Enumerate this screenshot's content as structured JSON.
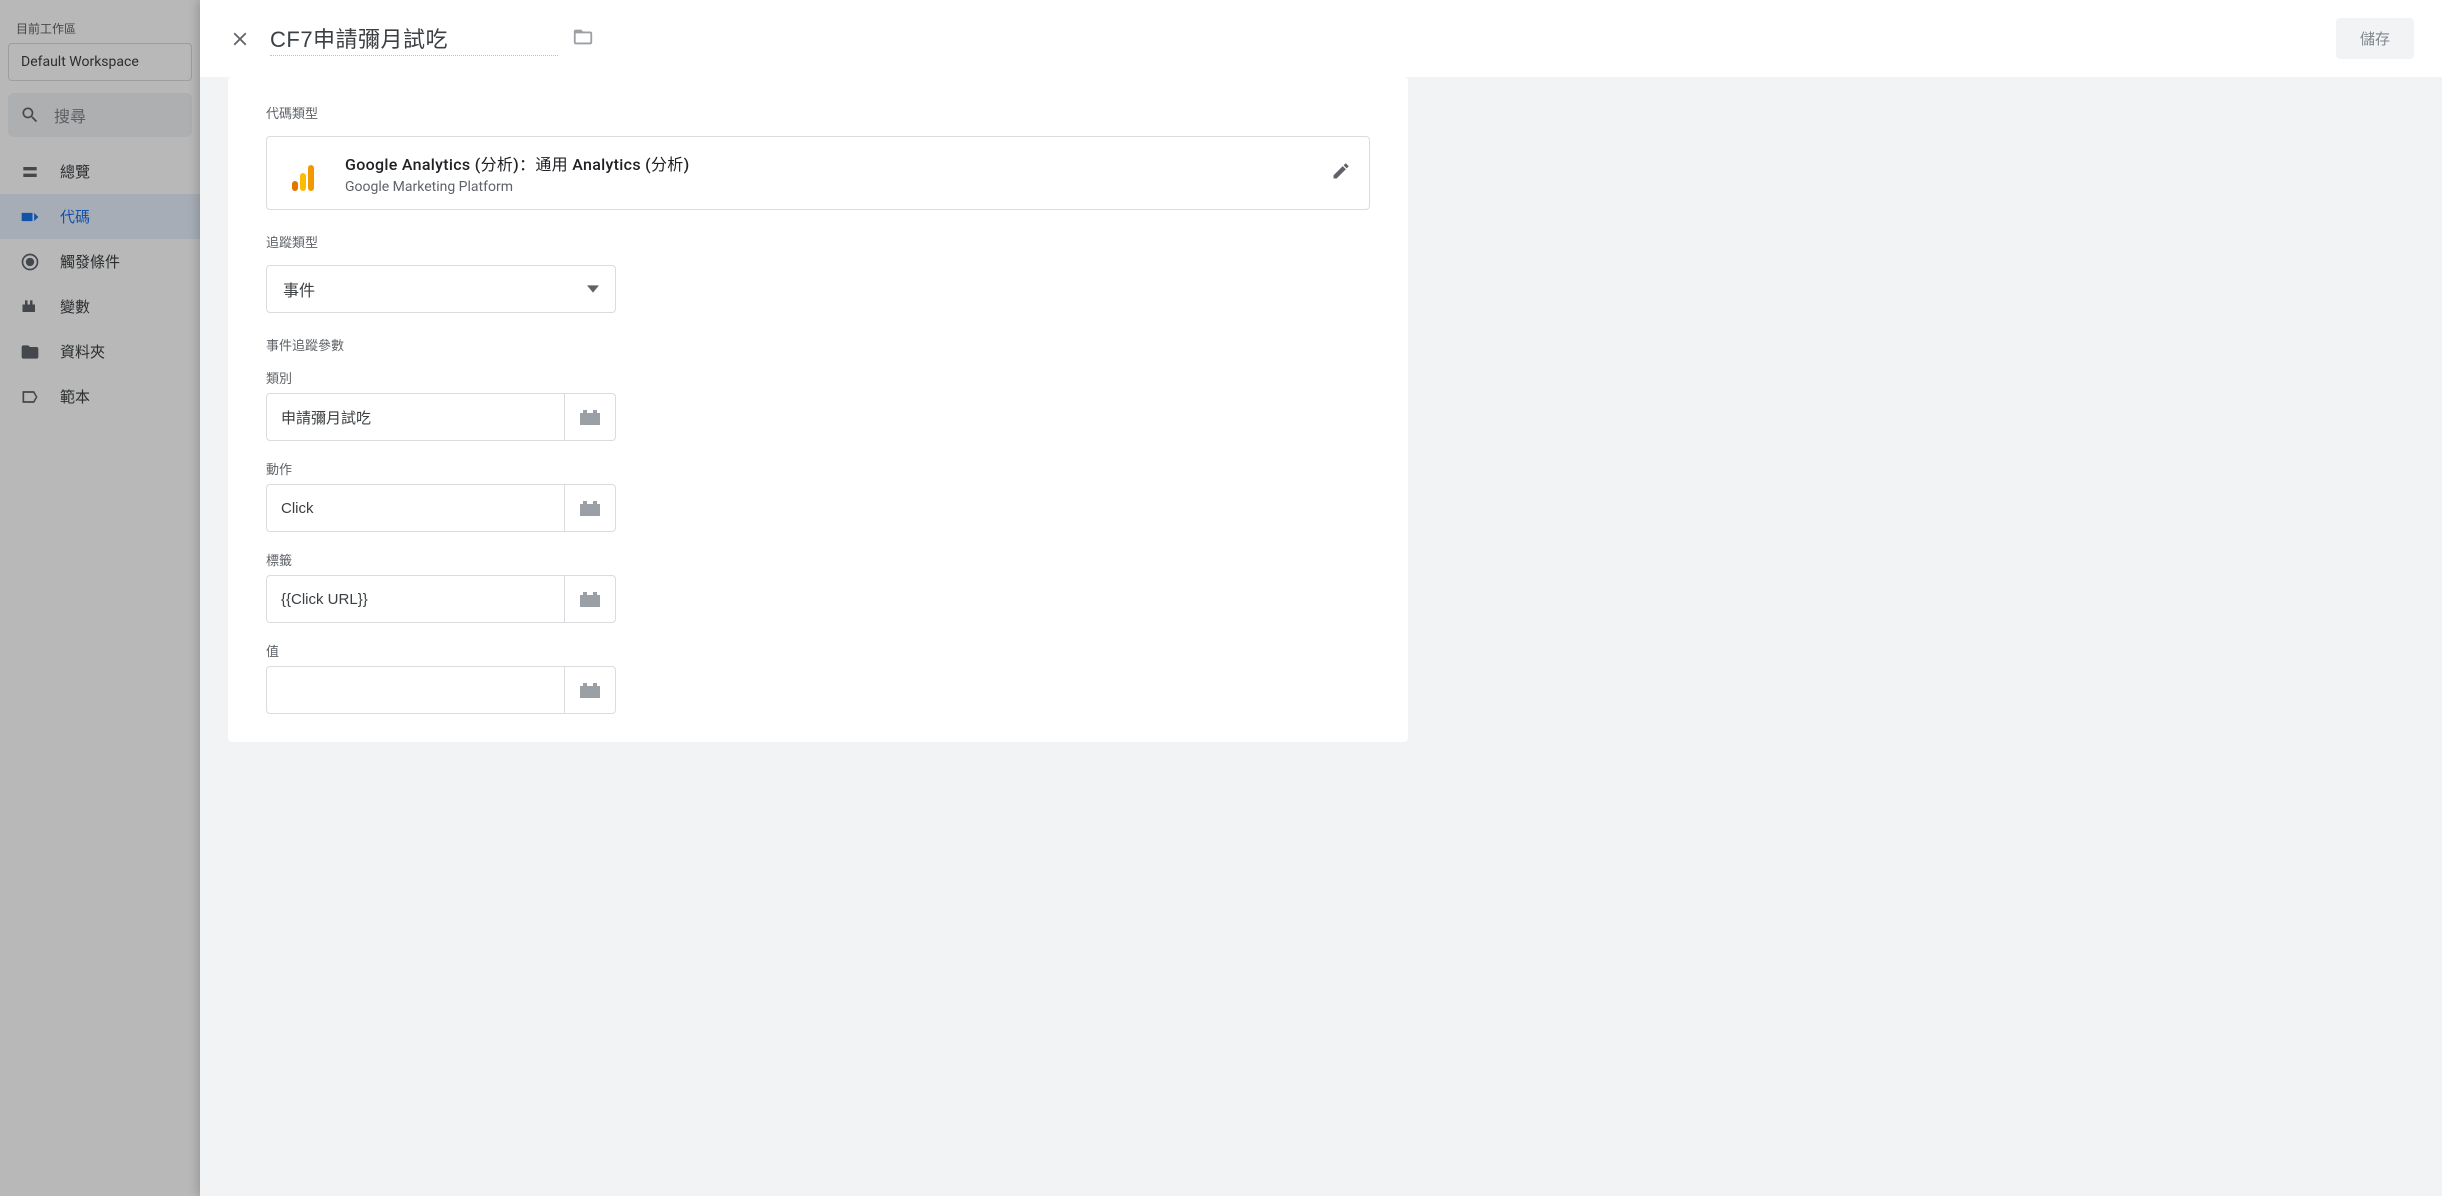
{
  "sidebar": {
    "currentWorkspaceLabel": "目前工作區",
    "workspaceName": "Default Workspace",
    "searchPlaceholder": "搜尋",
    "nav": {
      "overview": "總覽",
      "tags": "代碼",
      "triggers": "觸發條件",
      "variables": "變數",
      "folders": "資料夾",
      "templates": "範本"
    }
  },
  "header": {
    "title": "CF7申請彌月試吃",
    "save": "儲存"
  },
  "form": {
    "tagTypeLabel": "代碼類型",
    "tagType": {
      "name": "Google Analytics (分析)：通用 Analytics (分析)",
      "platform": "Google Marketing Platform"
    },
    "trackTypeLabel": "追蹤類型",
    "trackTypeValue": "事件",
    "eventParamsLabel": "事件追蹤參數",
    "categoryLabel": "類別",
    "categoryValue": "申請彌月試吃",
    "actionLabel": "動作",
    "actionValue": "Click",
    "labelLabel": "標籤",
    "labelValue": "{{Click URL}}",
    "valueLabel": "值",
    "valueValue": ""
  }
}
